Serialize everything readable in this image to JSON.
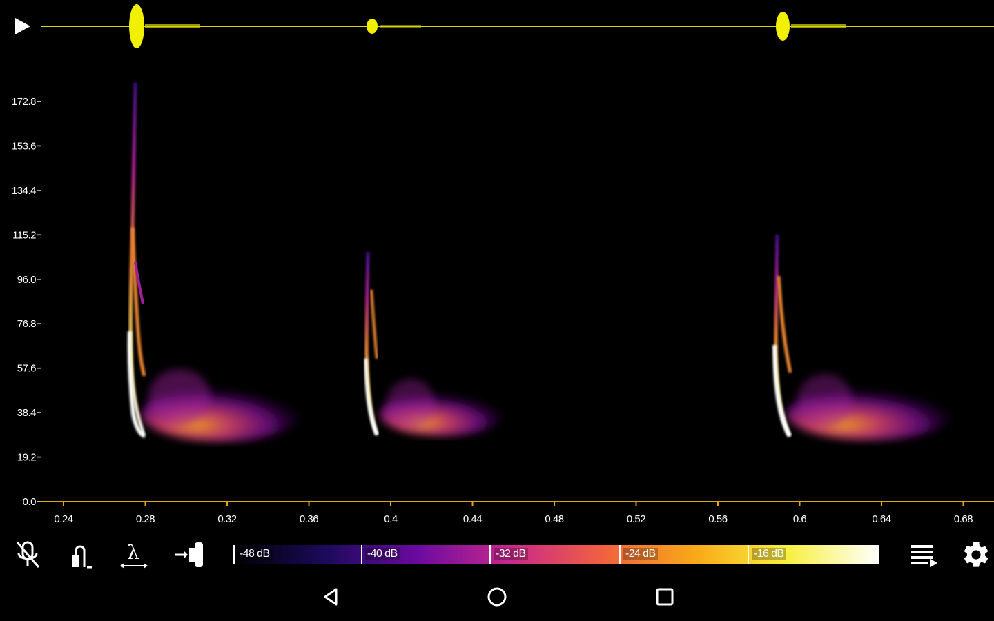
{
  "toolbar": {
    "icons": [
      "mic-off-icon",
      "trigger-icon",
      "wavelength-icon",
      "speaker-icon",
      "playlist-icon",
      "gear-icon"
    ]
  },
  "spectrogram": {
    "y_ticks": [
      "172.8",
      "153.6",
      "134.4",
      "115.2",
      "96.0",
      "76.8",
      "57.6",
      "38.4",
      "19.2",
      "0.0"
    ],
    "x_ticks": [
      "0.24",
      "0.28",
      "0.32",
      "0.36",
      "0.4",
      "0.44",
      "0.48",
      "0.52",
      "0.56",
      "0.6",
      "0.64",
      "0.68"
    ],
    "colors": {
      "axis": "#e8a400",
      "waveform": "#e6e600",
      "background": "#000000"
    }
  },
  "colorbar": {
    "labels": [
      "-48 dB",
      "-40 dB",
      "-32 dB",
      "-24 dB",
      "-16 dB"
    ],
    "gradient": [
      "#000000",
      "#1b0a5a",
      "#6a0aa0",
      "#c8288c",
      "#f06040",
      "#f8a818",
      "#f8f040",
      "#ffffff"
    ]
  },
  "navbar": {
    "icons": [
      "back-icon",
      "home-icon",
      "recents-icon"
    ]
  }
}
